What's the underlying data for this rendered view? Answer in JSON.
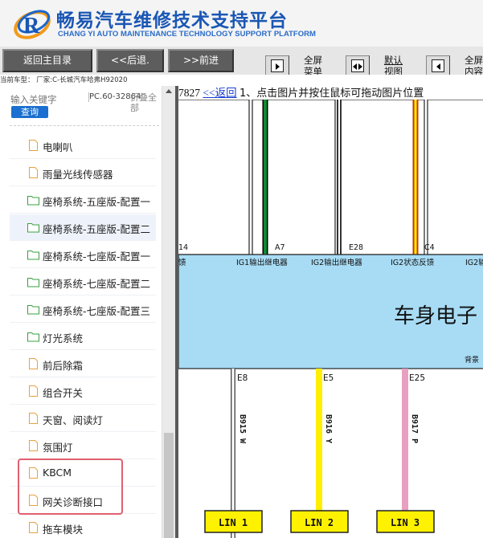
{
  "header": {
    "title": "畅易汽车维修技术支持平台",
    "subtitle": "CHANG YI AUTO MAINTENANCE TECHNOLOGY SUPPORT PLATFORM"
  },
  "toolbar": {
    "back_main": "返回主目录",
    "back": "<<后退.",
    "forward": ">>前进",
    "fullscreen_menu_1": "全屏",
    "fullscreen_menu_2": "菜单",
    "default_view_1": "默认",
    "default_view_2": "视图",
    "fullscreen_content_1": "全屏",
    "fullscreen_content_2": "内容"
  },
  "carline": "当前车型： 厂家:C-长城汽车哈弗H92020",
  "sidebar": {
    "search_placeholder": "输入关键字",
    "query_button": "查询",
    "pc_code": "PC.60-32864",
    "collapse_all": "折叠全部",
    "items": [
      {
        "label": "电喇叭",
        "type": "file"
      },
      {
        "label": "雨量光线传感器",
        "type": "file"
      },
      {
        "label": "座椅系统-五座版-配置一",
        "type": "folder"
      },
      {
        "label": "座椅系统-五座版-配置二",
        "type": "folder"
      },
      {
        "label": "座椅系统-七座版-配置一",
        "type": "folder"
      },
      {
        "label": "座椅系统-七座版-配置二",
        "type": "folder"
      },
      {
        "label": "座椅系统-七座版-配置三",
        "type": "folder"
      },
      {
        "label": "灯光系统",
        "type": "folder"
      },
      {
        "label": "前后除霜",
        "type": "file"
      },
      {
        "label": "组合开关",
        "type": "file"
      },
      {
        "label": "天窗、阅读灯",
        "type": "file"
      },
      {
        "label": "氛围灯",
        "type": "file"
      },
      {
        "label": "KBCM",
        "type": "file"
      },
      {
        "label": "网关诊断接口",
        "type": "file"
      },
      {
        "label": "拖车模块",
        "type": "file"
      }
    ]
  },
  "diagram": {
    "code": "7827",
    "back_link": "<<返回",
    "instruction": "1、点击图片并按住鼠标可拖动图片位置",
    "pins_top": [
      "14",
      "A7",
      "E28",
      "C4"
    ],
    "signals": [
      "馈",
      "IG1输出继电器",
      "IG2输出继电器",
      "IG2状态反馈",
      "IG2输"
    ],
    "module_name": "车身电子",
    "module_note": "背景",
    "pins_bottom": [
      "E8",
      "E5",
      "E25"
    ],
    "wires": [
      "B915 W",
      "B916 Y",
      "B917 P"
    ],
    "lin_labels": [
      "LIN 1",
      "LIN 2",
      "LIN 3"
    ]
  },
  "colors": {
    "brand_blue": "#1a56b4",
    "module_fill": "#a8dcf5",
    "wire_green": "#118833",
    "wire_yellow": "#ffee00",
    "wire_pink": "#e8a0c0",
    "lin_fill": "#fff200",
    "highlight_box": "#e06070",
    "query_button": "#1a6fd0"
  }
}
